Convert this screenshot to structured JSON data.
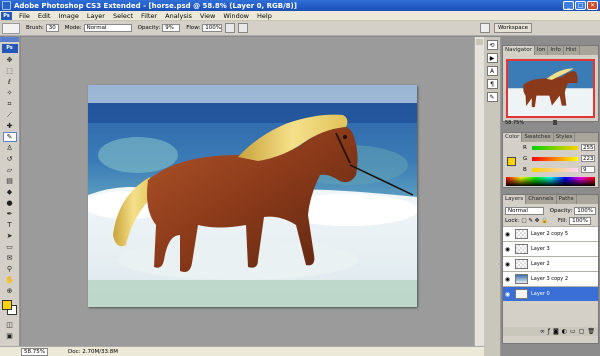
{
  "window": {
    "title": "Adobe Photoshop CS3 Extended - [horse.psd @ 58.8% (Layer 0, RGB/8)]"
  },
  "menubar": {
    "logo": "Ps",
    "items": [
      "File",
      "Edit",
      "Image",
      "Layer",
      "Select",
      "Filter",
      "Analysis",
      "View",
      "Window",
      "Help"
    ]
  },
  "options": {
    "brush_label": "Brush:",
    "brush_size": "30",
    "mode_label": "Mode:",
    "mode_value": "Normal",
    "opacity_label": "Opacity:",
    "opacity_value": "9%",
    "flow_label": "Flow:",
    "flow_value": "100%",
    "workspace_label": "Workspace"
  },
  "statusbar": {
    "zoom": "58.75%",
    "doc_size": "Doc: 2.70M/33.8M"
  },
  "navigator": {
    "tabs": [
      "Navigator",
      "Ion",
      "Info",
      "Hist"
    ],
    "zoom": "58.75%"
  },
  "color_panel": {
    "tabs": [
      "Color",
      "Swatches",
      "Styles"
    ],
    "channels": [
      {
        "label": "R",
        "value": "255",
        "gradient": "linear-gradient(90deg,#00d200,#ffd200)"
      },
      {
        "label": "G",
        "value": "223",
        "gradient": "linear-gradient(90deg,#ff0000,#ffff00)"
      },
      {
        "label": "B",
        "value": "9",
        "gradient": "linear-gradient(90deg,#ffd200,#ffd2ff)"
      }
    ],
    "foreground": "#ffd200"
  },
  "layers_panel": {
    "tabs": [
      "Layers",
      "Channels",
      "Paths"
    ],
    "blend_mode": "Normal",
    "opacity_label": "Opacity:",
    "opacity_value": "100%",
    "lock_label": "Lock:",
    "fill_label": "Fill:",
    "fill_value": "100%",
    "layers": [
      {
        "name": "Layer 2 copy 5",
        "selected": false,
        "thumb": "trans"
      },
      {
        "name": "Layer 3",
        "selected": false,
        "thumb": "trans"
      },
      {
        "name": "Layer 2",
        "selected": false,
        "thumb": "trans"
      },
      {
        "name": "Layer 3 copy 2",
        "selected": false,
        "thumb": "horse"
      },
      {
        "name": "Layer 0",
        "selected": true,
        "thumb": "white"
      }
    ]
  },
  "tools": [
    "move-tool",
    "marquee-tool",
    "lasso-tool",
    "magic-wand-tool",
    "crop-tool",
    "slice-tool",
    "healing-tool",
    "brush-tool",
    "clone-stamp-tool",
    "history-brush-tool",
    "eraser-tool",
    "gradient-tool",
    "blur-tool",
    "dodge-tool",
    "pen-tool",
    "type-tool",
    "path-select-tool",
    "shape-tool",
    "notes-tool",
    "eyedropper-tool",
    "hand-tool",
    "zoom-tool"
  ]
}
